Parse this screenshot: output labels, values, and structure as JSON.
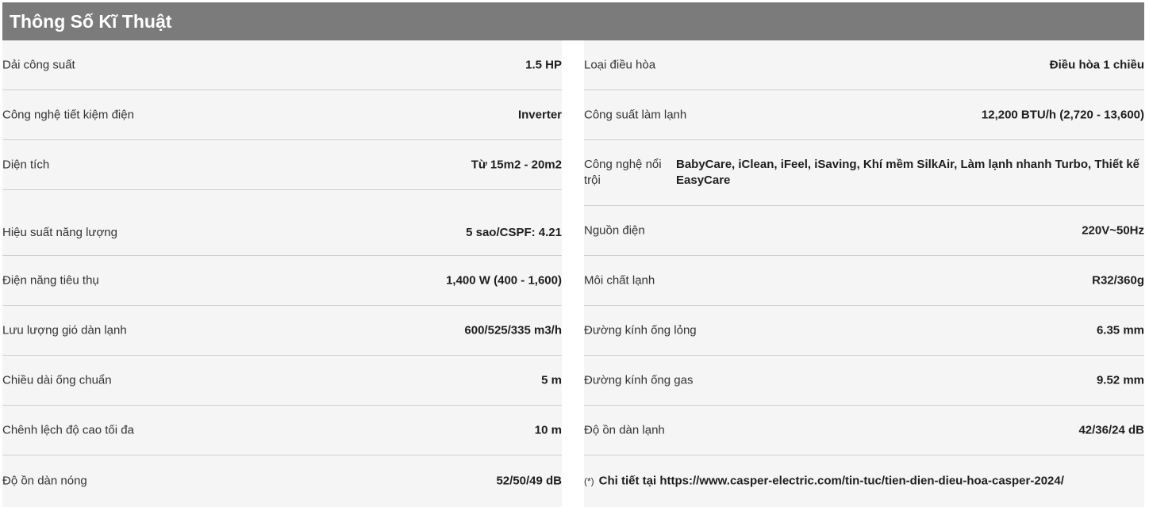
{
  "header": {
    "title": "Thông Số Kĩ Thuật"
  },
  "left": [
    {
      "label": "Dải công suất",
      "value": "1.5 HP"
    },
    {
      "label": "Công nghệ tiết kiệm điện",
      "value": "Inverter"
    },
    {
      "label": "Diện tích",
      "value": "Từ 15m2 - 20m2"
    },
    {
      "label": "Hiệu suất năng lượng",
      "value": "5 sao/CSPF: 4.21"
    },
    {
      "label": "Điện năng tiêu thụ",
      "value": "1,400 W (400 - 1,600)"
    },
    {
      "label": "Lưu lượng gió dàn lạnh",
      "value": "600/525/335 m3/h"
    },
    {
      "label": "Chiều dài ống chuẩn",
      "value": "5 m"
    },
    {
      "label": "Chênh lệch độ cao tối đa",
      "value": "10 m"
    },
    {
      "label": "Độ ồn dàn nóng",
      "value": "52/50/49 dB"
    }
  ],
  "right": [
    {
      "label": "Loại điều hòa",
      "value": "Điều hòa 1 chiều"
    },
    {
      "label": "Công suất làm lạnh",
      "value": "12,200 BTU/h (2,720 - 13,600)"
    },
    {
      "label": "Công nghệ nổi trội",
      "value": "BabyCare, iClean, iFeel, iSaving, Khí mềm SilkAir, Làm lạnh nhanh Turbo, Thiết kế EasyCare"
    },
    {
      "label": "Nguồn điện",
      "value": "220V~50Hz"
    },
    {
      "label": "Môi chất lạnh",
      "value": "R32/360g"
    },
    {
      "label": "Đường kính ống lỏng",
      "value": "6.35 mm"
    },
    {
      "label": "Đường kính ống gas",
      "value": "9.52 mm"
    },
    {
      "label": "Độ ồn dàn lạnh",
      "value": "42/36/24 dB"
    }
  ],
  "note": {
    "mark": "(*)",
    "text": "Chi tiết tại https://www.casper-electric.com/tin-tuc/tien-dien-dieu-hoa-casper-2024/"
  }
}
